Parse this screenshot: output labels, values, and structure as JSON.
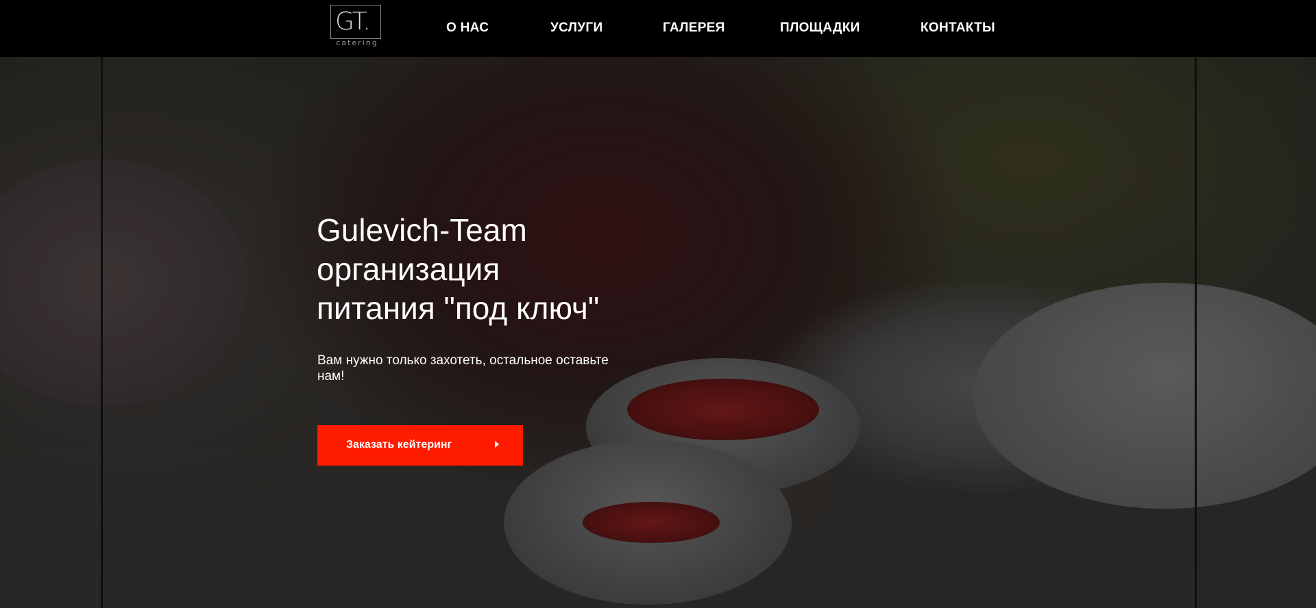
{
  "logo": {
    "mark": "GT.",
    "subtitle": "catering"
  },
  "nav": {
    "items": [
      {
        "label": "О НАС"
      },
      {
        "label": "УСЛУГИ"
      },
      {
        "label": "ГАЛЕРЕЯ"
      },
      {
        "label": "ПЛОЩАДКИ"
      },
      {
        "label": "КОНТАКТЫ"
      }
    ]
  },
  "hero": {
    "title_lines": [
      "Gulevich-Team",
      "организация",
      "питания \"под ключ\""
    ],
    "subtitle": "Вам нужно только захотеть, остальное оставьте нам!",
    "cta_label": "Заказать кейтеринг"
  },
  "colors": {
    "accent": "#ff1b00",
    "header_bg": "#000000"
  }
}
